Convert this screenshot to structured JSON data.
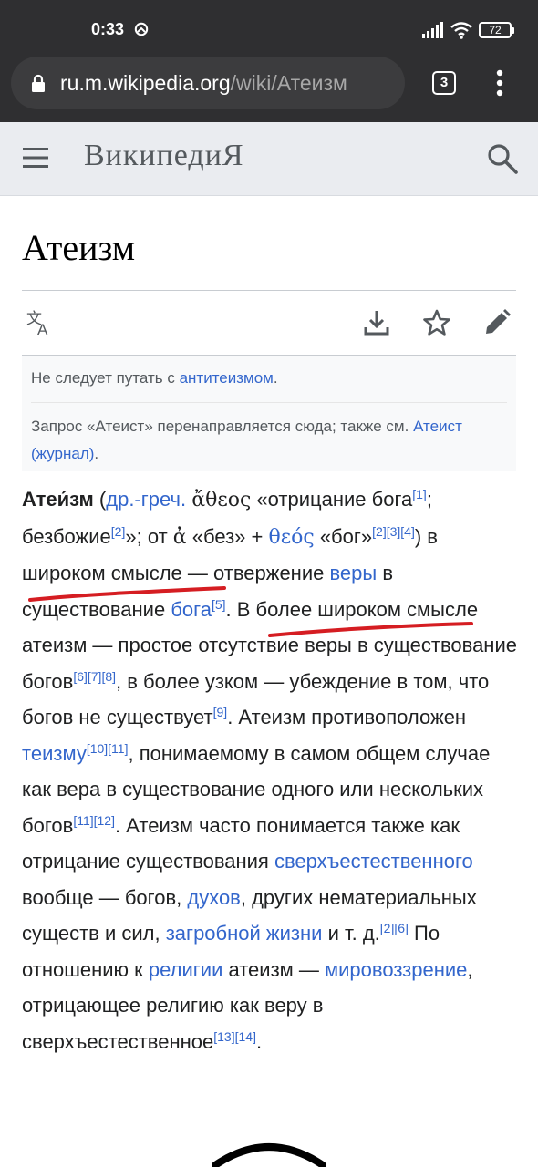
{
  "status_bar": {
    "time": "0:33",
    "battery": "72"
  },
  "browser": {
    "url_host": "ru.m.wikipedia.org",
    "url_path": "/wiki/Атеизм",
    "tab_count": "3"
  },
  "header": {
    "logo": "ВикипедиЯ"
  },
  "page": {
    "title": "Атеизм"
  },
  "hatnote": {
    "line1_prefix": "Не следует путать с ",
    "line1_link": "антитеизмом",
    "line1_suffix": ".",
    "line2_text": "Запрос «Атеист» перенаправляется сюда; также см. ",
    "line2_link": "Атеист (журнал)",
    "line2_suffix": "."
  },
  "article": {
    "t1": "Атеи́зм",
    "t2": " (",
    "l_greek": "др.-греч.",
    "t3": " ",
    "g1": "ἄθεος",
    "t4": " «отрицание бога",
    "r1": "[1]",
    "t5": "; безбожие",
    "r2": "[2]",
    "t6": "»; от ",
    "g2": "ἀ",
    "t7": " «без» + ",
    "l_theos": "θεός",
    "t8": " «бог»",
    "r3": "[2][3][4]",
    "t9": ") в широком смысле — отвержение ",
    "l_faith": "веры",
    "t10": " в существование ",
    "l_god": "бога",
    "r4": "[5]",
    "t11": ". В более широком смысле атеизм — простое отсутствие веры в существование богов",
    "r5": "[6][7][8]",
    "t12": ", в более узком — убеждение в том, что богов не существует",
    "r6": "[9]",
    "t13": ". Атеизм противоположен ",
    "l_theism": "теизму",
    "r7": "[10][11]",
    "t14": ", понимаемому в самом общем случае как вера в существование одного или нескольких богов",
    "r8": "[11][12]",
    "t15": ". Атеизм часто понимается также как отрицание существования ",
    "l_super": "сверхъестественного",
    "t16": " вообще — богов, ",
    "l_spirits": "духов",
    "t17": ", других нематериальных существ и сил, ",
    "l_afterlife": "загробной жизни",
    "t18": " и т. д.",
    "r9": "[2][6]",
    "t19": " По отношению к ",
    "l_religion": "религии",
    "t20": " атеизм — ",
    "l_worldview": "мировоззрение",
    "t21": ", отрицающее религию как веру в сверхъестественное",
    "r10": "[13][14]",
    "t22": "."
  },
  "colors": {
    "link": "#3366cc",
    "annotation": "#d51d22",
    "chrome": "#2f2f31",
    "header_bg": "#eaecf0"
  },
  "icons": [
    "alarm-icon",
    "signal-icon",
    "wifi-icon",
    "battery-icon",
    "lock-icon",
    "tabs-icon",
    "more-vert-icon",
    "menu-icon",
    "search-icon",
    "language-icon",
    "download-icon",
    "star-icon",
    "edit-icon"
  ]
}
